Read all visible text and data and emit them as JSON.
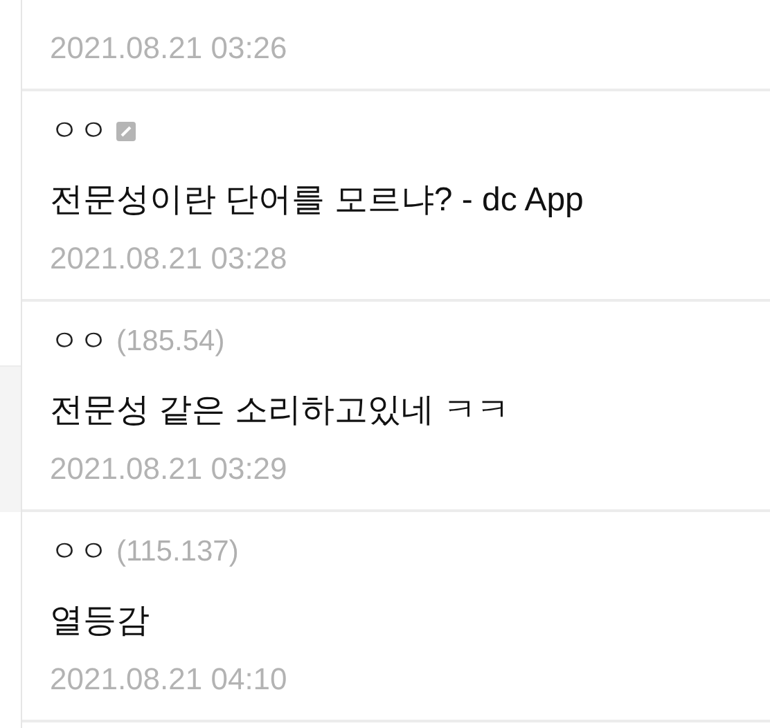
{
  "comments": [
    {
      "date": "2021.08.21 03:26"
    },
    {
      "nickname": "ㅇㅇ",
      "badge": true,
      "text": "전문성이란 단어를 모르냐? - dc App",
      "date": "2021.08.21 03:28"
    },
    {
      "nickname": "ㅇㅇ",
      "badge": false,
      "ip": "(185.54)",
      "text": "전문성 같은 소리하고있네 ㅋㅋ",
      "date": "2021.08.21 03:29"
    },
    {
      "nickname": "ㅇㅇ",
      "badge": false,
      "ip": "(115.137)",
      "text": "열등감",
      "date": "2021.08.21 04:10"
    }
  ]
}
